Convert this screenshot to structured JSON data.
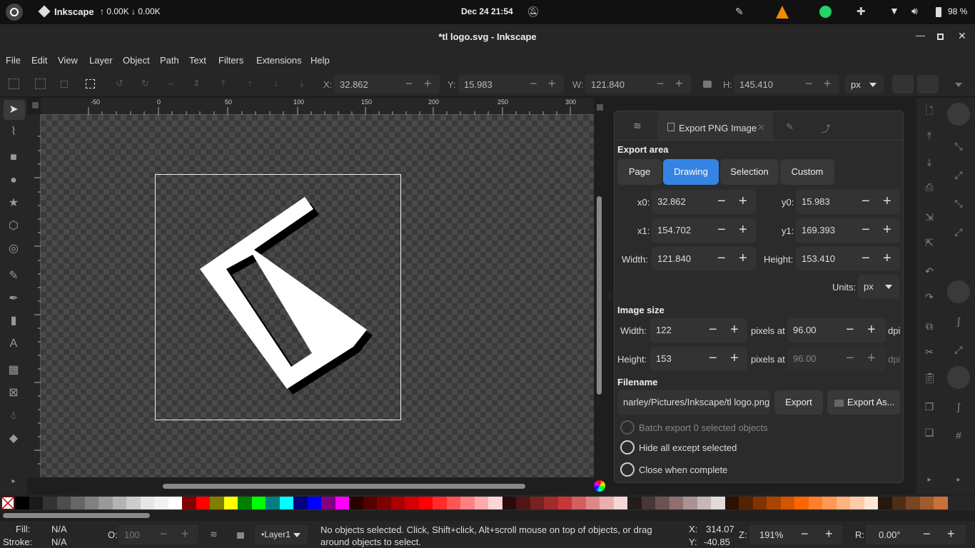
{
  "topbar": {
    "app_name": "Inkscape",
    "net": "↑ 0.00K ↓ 0.00K",
    "clock": "Dec 24  21:54",
    "battery": "98 %"
  },
  "window": {
    "title": "*tl logo.svg - Inkscape"
  },
  "menu": [
    "File",
    "Edit",
    "View",
    "Layer",
    "Object",
    "Path",
    "Text",
    "Filters",
    "Extensions",
    "Help"
  ],
  "toolctrl": {
    "x_label": "X:",
    "x": "32.862",
    "y_label": "Y:",
    "y": "15.983",
    "w_label": "W:",
    "w": "121.840",
    "h_label": "H:",
    "h": "145.410",
    "unit": "px"
  },
  "ruler": {
    "ticks": [
      "-50",
      "0",
      "50",
      "100",
      "150",
      "200",
      "250",
      "300"
    ]
  },
  "dialog": {
    "tab_title": "Export PNG Image",
    "export_area_label": "Export area",
    "area_buttons": [
      "Page",
      "Drawing",
      "Selection",
      "Custom"
    ],
    "active_area": "Drawing",
    "x0_label": "x0:",
    "x0": "32.862",
    "y0_label": "y0:",
    "y0": "15.983",
    "x1_label": "x1:",
    "x1": "154.702",
    "y1_label": "y1:",
    "y1": "169.393",
    "width_label": "Width:",
    "width": "121.840",
    "height_label": "Height:",
    "height": "153.410",
    "units_label": "Units:",
    "units": "px",
    "image_size_label": "Image size",
    "img_width_label": "Width:",
    "img_width": "122",
    "img_height_label": "Height:",
    "img_height": "153",
    "pixels_at": "pixels at",
    "dpi_value": "96.00",
    "dpi_value2": "96.00",
    "dpi_label": "dpi",
    "filename_label": "Filename",
    "filename": "narley/Pictures/Inkscape/tl logo.png",
    "export_button": "Export",
    "export_as_button": "Export As...",
    "batch_export": "Batch export 0 selected objects",
    "hide_all": "Hide all except selected",
    "close_when_complete": "Close when complete"
  },
  "status": {
    "fill_label": "Fill:",
    "fill": "N/A",
    "stroke_label": "Stroke:",
    "stroke": "N/A",
    "opacity_label": "O:",
    "opacity": "100",
    "layer": "•Layer1",
    "message": "No objects selected. Click, Shift+click, Alt+scroll mouse on top of objects, or drag around objects to select.",
    "x_label": "X:",
    "x": "314.07",
    "y_label": "Y:",
    "y": "-40.85",
    "zoom_label": "Z:",
    "zoom": "191%",
    "rot_label": "R:",
    "rot": "0.00°"
  },
  "colors": {
    "accent": "#3584e4",
    "palette": [
      "#000000",
      "#1a1a1a",
      "#333333",
      "#4d4d4d",
      "#666666",
      "#808080",
      "#999999",
      "#b3b3b3",
      "#cccccc",
      "#e6e6e6",
      "#f2f2f2",
      "#ffffff",
      "#800000",
      "#ff0000",
      "#808000",
      "#ffff00",
      "#008000",
      "#00ff00",
      "#008080",
      "#00ffff",
      "#000080",
      "#0000ff",
      "#800080",
      "#ff00ff",
      "#2b0000",
      "#550000",
      "#800000",
      "#aa0000",
      "#d40000",
      "#ff0000",
      "#ff2a2a",
      "#ff5555",
      "#ff8080",
      "#ffaaaa",
      "#ffd5d5",
      "#280b0b",
      "#501616",
      "#782121",
      "#a02c2c",
      "#c83737",
      "#d35f5f",
      "#de8787",
      "#e9afaf",
      "#f4d7d7",
      "#241c1c",
      "#483737",
      "#6c5353",
      "#916f6f",
      "#ac9393",
      "#c8b7b7",
      "#e3dbdb",
      "#2b1100",
      "#552200",
      "#803300",
      "#aa4400",
      "#d45500",
      "#ff6600",
      "#ff7f2a",
      "#ff9955",
      "#ffb380",
      "#ffccaa",
      "#ffe6d5",
      "#28170b",
      "#502d16",
      "#784421",
      "#a05a2c",
      "#c87137"
    ]
  }
}
